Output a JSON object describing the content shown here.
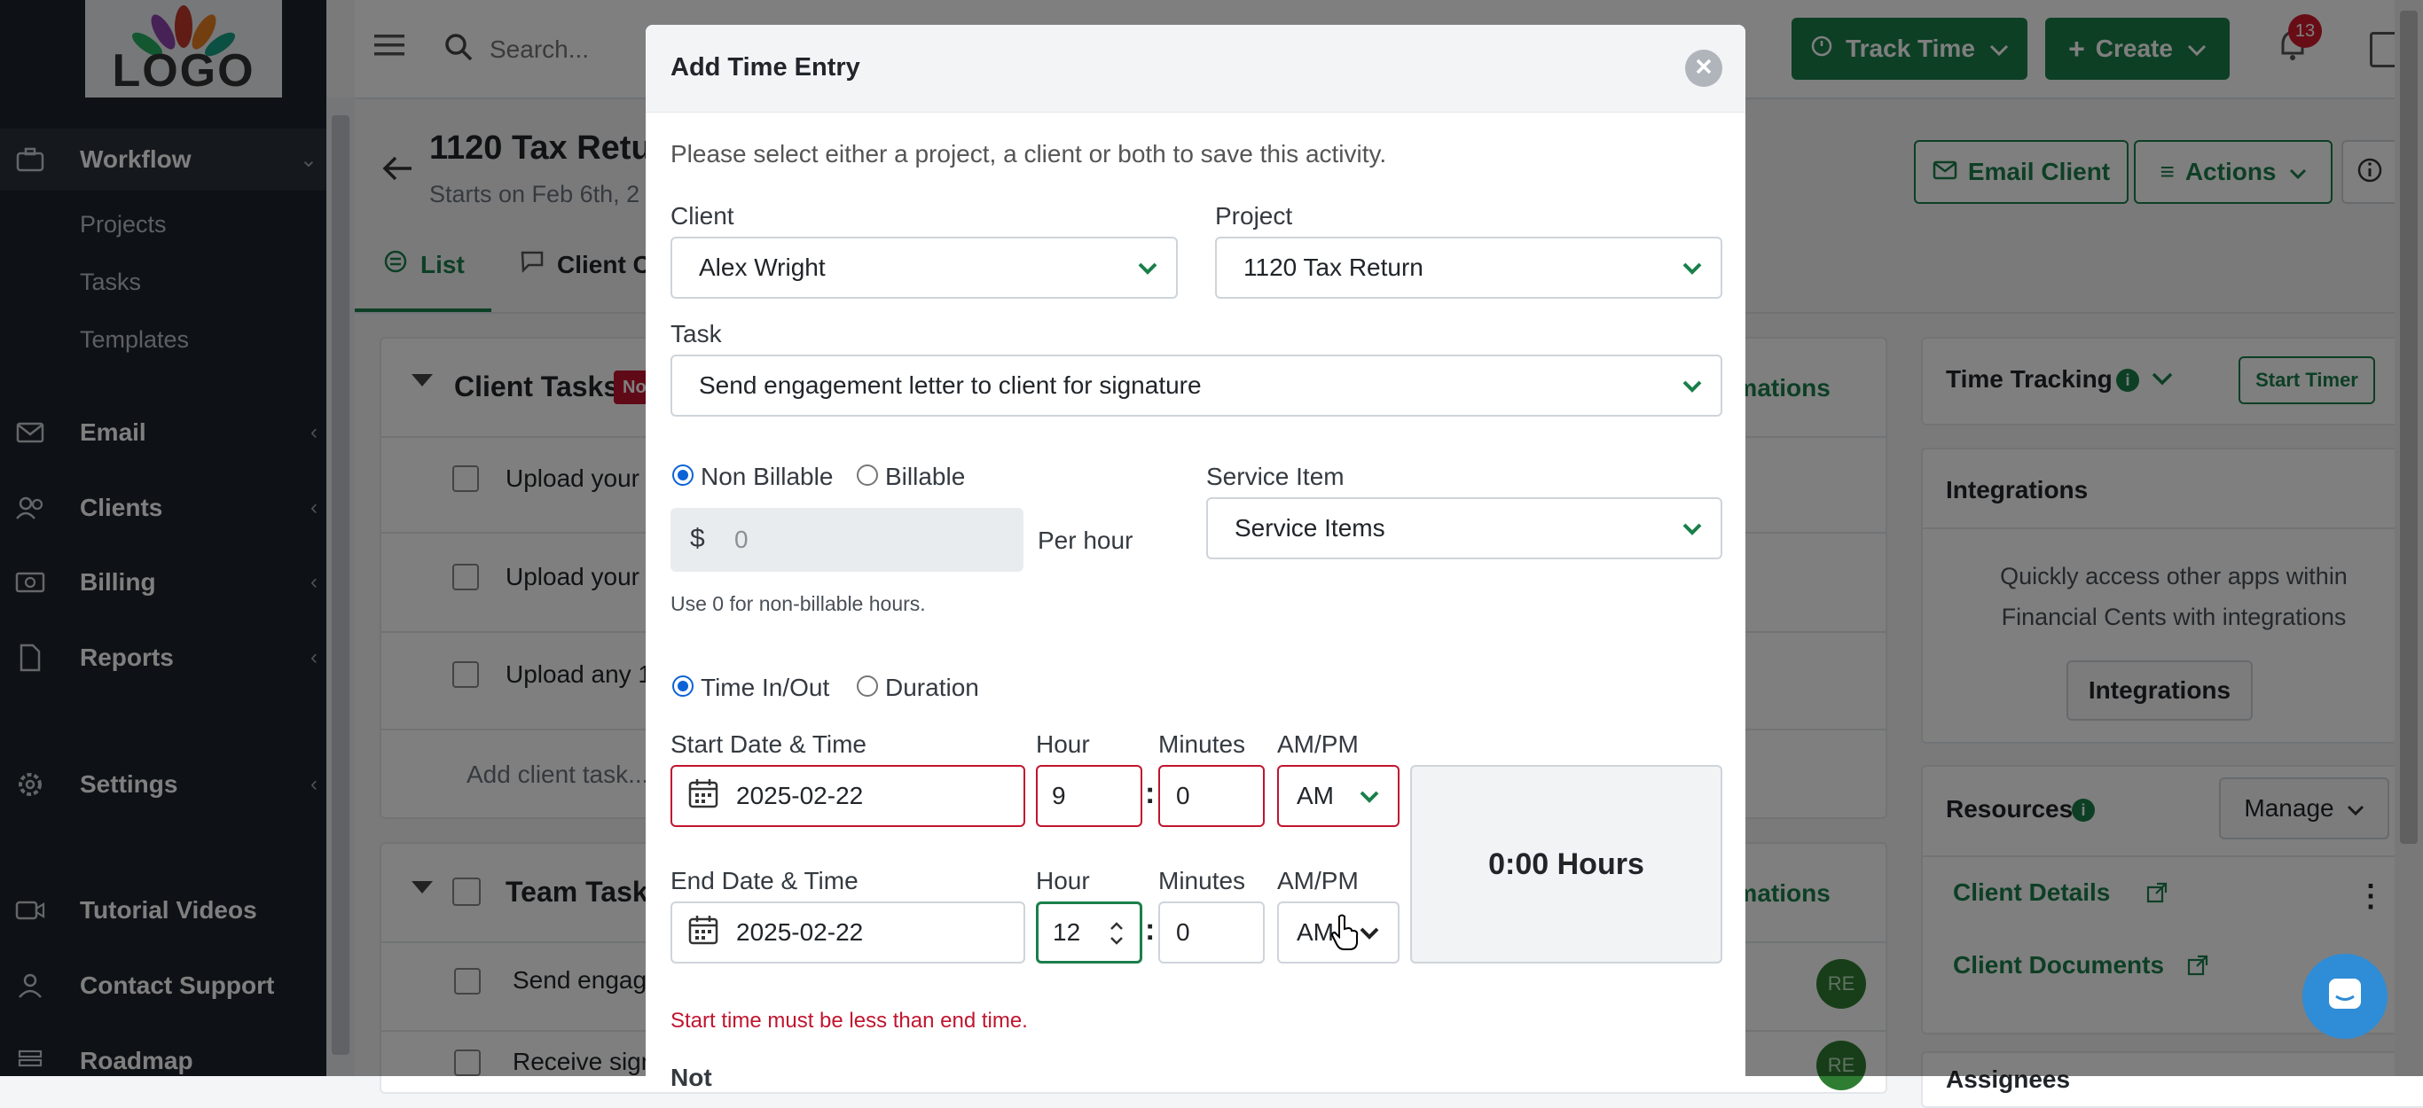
{
  "app": {
    "logo_text": "LOGO",
    "search_placeholder": "Search...",
    "track_time_label": "Track Time",
    "create_label": "Create",
    "notification_count": "13",
    "page_title": "1120 Tax Retur",
    "page_subtitle": "Starts on Feb 6th, 2",
    "tabs": [
      "List",
      "Client C"
    ],
    "email_client_label": "Email Client",
    "actions_label": "Actions"
  },
  "sidebar": {
    "items": [
      {
        "label": "Workflow",
        "icon": "briefcase-icon"
      },
      {
        "label": "Email",
        "icon": "envelope-icon"
      },
      {
        "label": "Clients",
        "icon": "users-icon"
      },
      {
        "label": "Billing",
        "icon": "money-icon"
      },
      {
        "label": "Reports",
        "icon": "file-icon"
      },
      {
        "label": "Settings",
        "icon": "gear-icon"
      },
      {
        "label": "Tutorial Videos",
        "icon": "video-icon"
      },
      {
        "label": "Contact Support",
        "icon": "user-icon"
      },
      {
        "label": "Roadmap",
        "icon": "roadmap-icon"
      }
    ],
    "sub_items": [
      "Projects",
      "Tasks",
      "Templates"
    ]
  },
  "background": {
    "client_tasks_title": "Client Tasks",
    "client_tasks_badge": "No",
    "automations_label": "tomations",
    "tasks": [
      "Upload your l",
      "Upload your p",
      "Upload any 1"
    ],
    "add_client_task": "Add client task...",
    "team_tasks_title": "Team Task",
    "team_tasks": [
      "Send engag",
      "Receive sign"
    ],
    "avatar_initials": "RE"
  },
  "right_panel": {
    "time_tracking_title": "Time Tracking",
    "start_timer_label": "Start Timer",
    "integrations_title": "Integrations",
    "integrations_text_1": "Quickly access other apps within",
    "integrations_text_2": "Financial Cents with integrations",
    "integrations_button": "Integrations",
    "resources_title": "Resources",
    "manage_label": "Manage",
    "client_details_link": "Client Details",
    "client_documents_link": "Client Documents",
    "assignees_partial": "Assignees"
  },
  "modal": {
    "title": "Add Time Entry",
    "instruction": "Please select either a project, a client or both to save this activity.",
    "client_label": "Client",
    "client_value": "Alex Wright",
    "project_label": "Project",
    "project_value": "1120 Tax Return",
    "task_label": "Task",
    "task_value": "Send engagement letter to client for signature",
    "non_billable_label": "Non Billable",
    "billable_label": "Billable",
    "rate_prefix": "$",
    "rate_placeholder": "0",
    "per_hour_label": "Per hour",
    "rate_hint": "Use 0 for non-billable hours.",
    "service_item_label": "Service Item",
    "service_item_value": "Service Items",
    "time_in_out_label": "Time In/Out",
    "duration_label": "Duration",
    "start_label": "Start Date & Time",
    "start_date": "2025-02-22",
    "hour_label": "Hour",
    "start_hour": "9",
    "minutes_label": "Minutes",
    "start_minutes": "0",
    "ampm_label": "AM/PM",
    "start_ampm": "AM",
    "end_label": "End Date & Time",
    "end_date": "2025-02-22",
    "end_hour": "12",
    "end_minutes": "0",
    "end_ampm": "AM",
    "colon": ":",
    "total_hours": "0:00 Hours",
    "error_message": "Start time must be less than end time.",
    "notes_partial": "Not"
  },
  "colors": {
    "accent_green": "#1a7f4b",
    "error_red": "#c0152f",
    "sidebar_bg": "#1d232b",
    "radio_blue": "#0b63d6"
  }
}
